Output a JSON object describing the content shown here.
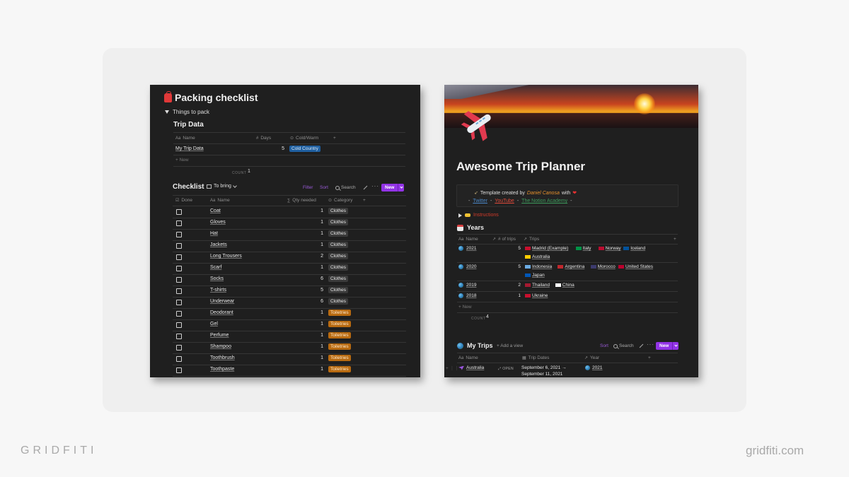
{
  "left": {
    "title": "Packing checklist",
    "toggle": "Things to pack",
    "trip_data": {
      "title": "Trip Data",
      "headers": [
        "Name",
        "Days",
        "Cold/Warm"
      ],
      "row": {
        "name": "My Trip Data",
        "days": "5",
        "type": "Cold Country"
      },
      "new_label": "New",
      "count_label": "COUNT",
      "count": "1"
    },
    "checklist": {
      "title": "Checklist",
      "view": "To bring",
      "filter": "Filter",
      "sort": "Sort",
      "search": "Search",
      "new": "New",
      "headers": [
        "Done",
        "Name",
        "Qty needed",
        "Category"
      ],
      "rows": [
        {
          "name": "Coat",
          "qty": "1",
          "cat": "Clothes"
        },
        {
          "name": "Gloves",
          "qty": "1",
          "cat": "Clothes"
        },
        {
          "name": "Hat",
          "qty": "1",
          "cat": "Clothes"
        },
        {
          "name": "Jackets",
          "qty": "1",
          "cat": "Clothes"
        },
        {
          "name": "Long Trousers",
          "qty": "2",
          "cat": "Clothes"
        },
        {
          "name": "Scarf",
          "qty": "1",
          "cat": "Clothes"
        },
        {
          "name": "Socks",
          "qty": "6",
          "cat": "Clothes"
        },
        {
          "name": "T-shirts",
          "qty": "5",
          "cat": "Clothes"
        },
        {
          "name": "Underwear",
          "qty": "6",
          "cat": "Clothes"
        },
        {
          "name": "Deodorant",
          "qty": "1",
          "cat": "Toiletries"
        },
        {
          "name": "Gel",
          "qty": "1",
          "cat": "Toiletries"
        },
        {
          "name": "Perfume",
          "qty": "1",
          "cat": "Toiletries"
        },
        {
          "name": "Shampoo",
          "qty": "1",
          "cat": "Toiletries"
        },
        {
          "name": "Toothbrush",
          "qty": "1",
          "cat": "Toiletries"
        },
        {
          "name": "Toothpaste",
          "qty": "1",
          "cat": "Toiletries"
        }
      ]
    }
  },
  "right": {
    "title": "Awesome Trip Planner",
    "callout": {
      "text_before": "Template created by",
      "author": "Daniel Canosa",
      "text_after": "with",
      "links": [
        "Twitter",
        "YouTube",
        "The Notion Academy"
      ],
      "separator": "-"
    },
    "instructions": "Instructions",
    "years": {
      "title": "Years",
      "headers": [
        "Name",
        "# of trips",
        "Trips"
      ],
      "rows": [
        {
          "year": "2021",
          "count": "5",
          "line1": [
            "Madrid (Example)",
            "Italy",
            "Norway",
            "Iceland"
          ],
          "line2": [
            "Australia"
          ]
        },
        {
          "year": "2020",
          "count": "5",
          "line1": [
            "Indonesia",
            "Argentina",
            "Morocco",
            "United States"
          ],
          "line2": [
            "Japan"
          ]
        },
        {
          "year": "2019",
          "count": "2",
          "line1": [
            "Thailand",
            "China"
          ],
          "line2": []
        },
        {
          "year": "2018",
          "count": "1",
          "line1": [
            "Ukraine"
          ],
          "line2": []
        }
      ],
      "new_label": "New",
      "count_label": "COUNT",
      "count": "4"
    },
    "my_trips": {
      "title": "My Trips",
      "add_view": "Add a view",
      "sort": "Sort",
      "search": "Search",
      "new": "New",
      "headers": [
        "Name",
        "Trip Dates",
        "Year"
      ],
      "row": {
        "name": "Australia",
        "open": "OPEN",
        "dates_line1": "September 6, 2021 →",
        "dates_line2": "September 11, 2021",
        "year": "2021"
      }
    }
  },
  "branding": {
    "left": "GRIDFITI",
    "right": "gridfiti.com"
  },
  "colors": {
    "panel_bg": "#1f1f1f",
    "accent_purple": "#9233e6",
    "tag_blue": "#1f5fa0",
    "tag_orange": "#b86a10",
    "brand_gray": "#a9a9a9"
  }
}
